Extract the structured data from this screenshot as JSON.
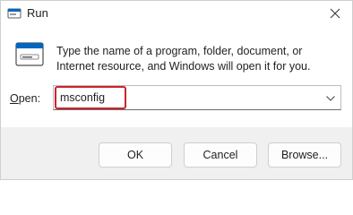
{
  "window": {
    "title": "Run"
  },
  "icons": {
    "app": "run-app-icon",
    "run": "run-dialog-icon",
    "close": "close-icon",
    "dropdown": "chevron-down-icon"
  },
  "description": "Type the name of a program, folder, document, or Internet resource, and Windows will open it for you.",
  "open": {
    "label_underlined": "O",
    "label_rest": "pen:",
    "value": "msconfig"
  },
  "buttons": {
    "ok": "OK",
    "cancel": "Cancel",
    "browse": "Browse..."
  },
  "colors": {
    "highlight": "#c9252c",
    "accent": "#0067c0"
  }
}
